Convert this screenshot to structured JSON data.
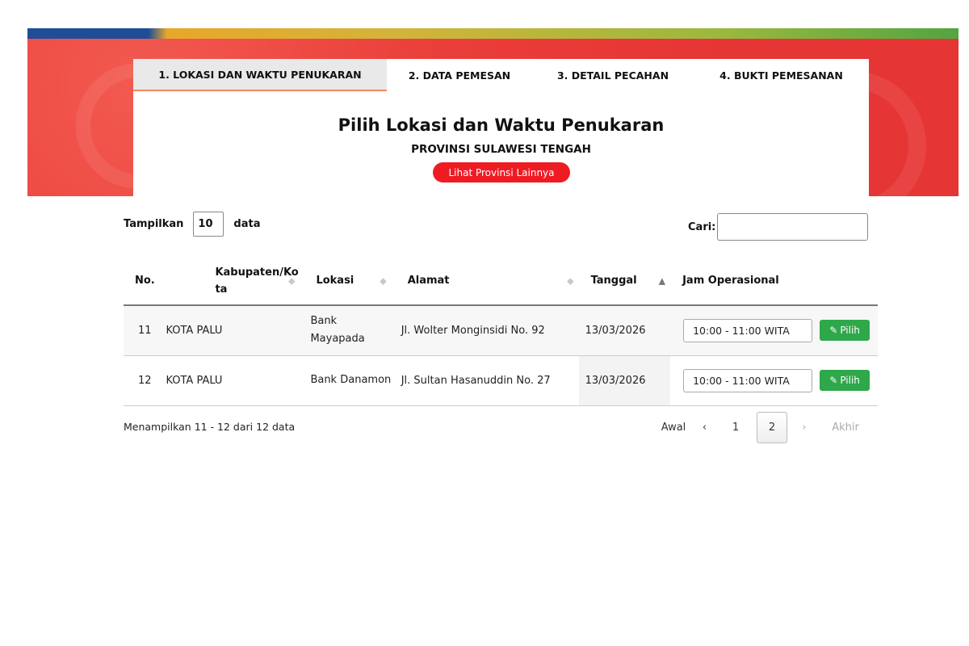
{
  "tabs": [
    {
      "label": "1. LOKASI DAN WAKTU PENUKARAN",
      "active": true
    },
    {
      "label": "2. DATA PEMESAN"
    },
    {
      "label": "3. DETAIL PECAHAN"
    },
    {
      "label": "4. BUKTI PEMESANAN"
    }
  ],
  "card": {
    "title": "Pilih Lokasi dan Waktu Penukaran",
    "subtitle": "PROVINSI SULAWESI TENGAH",
    "other_province_button": "Lihat Provinsi Lainnya"
  },
  "length": {
    "prefix": "Tampilkan",
    "value": "10",
    "suffix": "data"
  },
  "search": {
    "label": "Cari:",
    "value": ""
  },
  "table": {
    "headers": [
      "No.",
      "Kabupaten/Kota",
      "Lokasi",
      "Alamat",
      "Tanggal",
      "Jam Operasional"
    ],
    "rows": [
      {
        "no": "11",
        "kab": "KOTA PALU",
        "lokasi": "Bank Mayapada",
        "alamat": "Jl. Wolter Monginsidi No. 92",
        "tanggal": "13/03/2026",
        "jam": "10:00 - 11:00 WITA",
        "button": "Pilih"
      },
      {
        "no": "12",
        "kab": "KOTA PALU",
        "lokasi": "Bank Danamon",
        "alamat": "Jl. Sultan Hasanuddin No. 27",
        "tanggal": "13/03/2026",
        "jam": "10:00 - 11:00 WITA",
        "button": "Pilih"
      }
    ]
  },
  "info": "Menampilkan 11 - 12 dari 12 data",
  "pager": {
    "first": "Awal",
    "prev": "‹",
    "page1": "1",
    "page2": "2",
    "next": "›",
    "last": "Akhir"
  },
  "colors": {
    "accent": "#ef1b23",
    "button_green": "#2ea84a"
  }
}
